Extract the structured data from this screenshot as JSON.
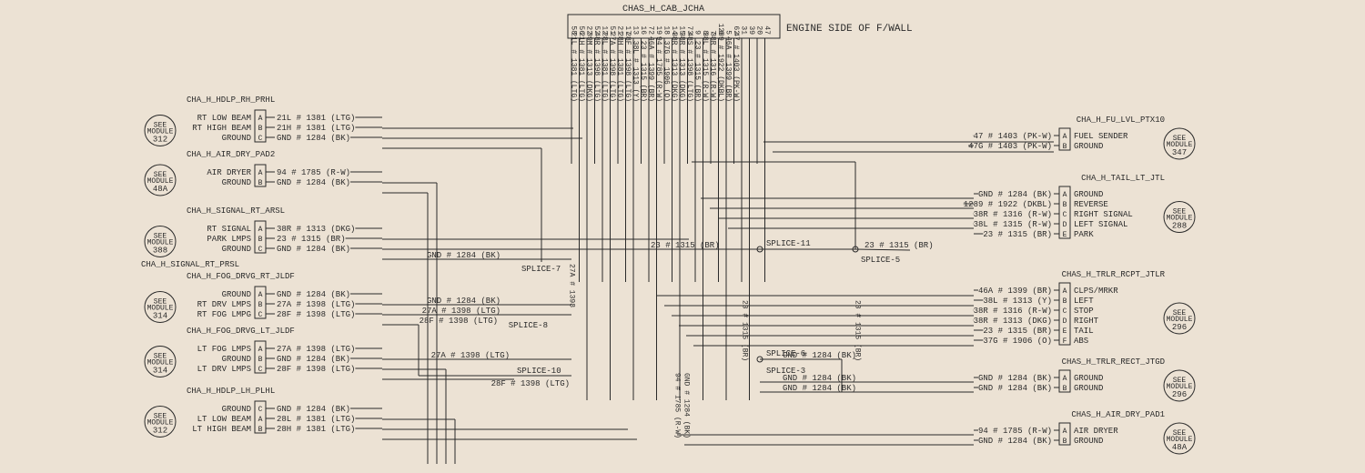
{
  "header": {
    "top_label": "CHAS_H_CAB_JCHA",
    "side_label": "ENGINE SIDE OF F/WALL",
    "pins": [
      "58",
      "56",
      "22",
      "52",
      "12",
      "51",
      "21",
      "17",
      "13",
      "16",
      "72",
      "19",
      "18",
      "14",
      "15",
      "73",
      "9",
      "8",
      "7",
      "6",
      "5",
      "62",
      "31",
      "39",
      "20",
      "47"
    ],
    "pin_wires": [
      "21L # 1381 (LTG)",
      "21H # 1381 (LTG)",
      "39M # 1313 (DKG)",
      "48R # 1398 (LTG)",
      "28L # 1381 (LTG)",
      "27A # 1398 (LTG)",
      "28H # 1381 (LTG)",
      "28F # 1398 (LTG)",
      "38L # 1313 (Y)",
      "23 # 1315 (BR)",
      "46A # 1399 (BR)",
      "94 # 1785 (R-W)",
      "37G # 1906 (O)",
      "38R # 1313 (DKG)",
      "38R # 1313 (DKG)",
      "48S # 1398 (LTG)",
      "23 # 1315 (BR)",
      "38L # 1315 (R-W)",
      "38R # 1316 (R-W)",
      "1289 # 1922 (DKBL)",
      "46A # 1399 (BR)",
      "47 # 1403 (PK-W)"
    ]
  },
  "left_connectors": [
    {
      "id": "CHA_H_HDLP_RH_PRHL",
      "module": "312",
      "pins": [
        "A",
        "B",
        "C"
      ],
      "labels": [
        "RT LOW BEAM",
        "RT HIGH BEAM",
        "GROUND"
      ],
      "wires": [
        "21L # 1381 (LTG)",
        "21H # 1381 (LTG)",
        "GND # 1284 (BK)"
      ]
    },
    {
      "id": "CHA_H_AIR_DRY_PAD2",
      "module": "48A",
      "pins": [
        "A",
        "B"
      ],
      "labels": [
        "AIR DRYER",
        "GROUND"
      ],
      "wires": [
        "94 # 1785 (R-W)",
        "GND # 1284 (BK)"
      ]
    },
    {
      "id": "CHA_H_SIGNAL_RT_ARSL",
      "module": "388",
      "pins": [
        "A",
        "B",
        "C"
      ],
      "labels": [
        "RT SIGNAL",
        "PARK LMPS",
        "GROUND"
      ],
      "wires": [
        "38R # 1313 (DKG)",
        "23 # 1315 (BR)",
        "GND # 1284 (BK)"
      ],
      "sub": "CHA_H_SIGNAL_RT_PRSL"
    },
    {
      "id": "CHA_H_FOG_DRVG_RT_JLDF",
      "module": "314",
      "pins": [
        "A",
        "B",
        "C"
      ],
      "labels": [
        "GROUND",
        "RT DRV LMPS",
        "RT FOG LMPG"
      ],
      "wires": [
        "GND # 1284 (BK)",
        "27A # 1398 (LTG)",
        "28F # 1398 (LTG)"
      ]
    },
    {
      "id": "CHA_H_FOG_DRVG_LT_JLDF",
      "module": "314",
      "pins": [
        "A",
        "B",
        "C"
      ],
      "labels": [
        "LT FOG LMPS",
        "GROUND",
        "LT DRV LMPS"
      ],
      "wires": [
        "27A # 1398 (LTG)",
        "GND # 1284 (BK)",
        "28F # 1398 (LTG)"
      ]
    },
    {
      "id": "CHA_H_HDLP_LH_PLHL",
      "module": "312",
      "pins": [
        "C",
        "A",
        "B"
      ],
      "labels": [
        "GROUND",
        "LT LOW BEAM",
        "LT HIGH BEAM"
      ],
      "wires": [
        "GND # 1284 (BK)",
        "28L # 1381 (LTG)",
        "28H # 1381 (LTG)"
      ]
    }
  ],
  "right_connectors": [
    {
      "id": "CHA_H_FU_LVL_PTX10",
      "module": "347",
      "pins": [
        "A",
        "B"
      ],
      "labels": [
        "FUEL SENDER",
        "GROUND"
      ],
      "wires": [
        "47 # 1403 (PK-W)",
        "47G # 1403 (PK-W)"
      ]
    },
    {
      "id": "CHA_H_TAIL_LT_JTL",
      "module": "288",
      "pins": [
        "A",
        "B",
        "C",
        "D"
      ],
      "labels": [
        "GROUND",
        "REVERSE",
        "RIGHT SIGNAL",
        "LEFT SIGNAL",
        "PARK"
      ],
      "wires": [
        "GND # 1284 (BK)",
        "1289 # 1922 (DKBL)",
        "38R # 1316 (R-W)",
        "38L # 1315 (R-W)",
        "23 # 1315 (BR)"
      ]
    },
    {
      "id": "CHAS_H_TRLR_RCPT_JTLR",
      "module": "296",
      "pins": [
        "A",
        "B",
        "C",
        "D",
        "E",
        "F"
      ],
      "labels": [
        "CLPS/MRKR",
        "LEFT",
        "STOP",
        "RIGHT",
        "TAIL",
        "ABS"
      ],
      "wires": [
        "46A # 1399 (BR)",
        "38L # 1313 (Y)",
        "38R # 1316 (R-W)",
        "38R # 1313 (DKG)",
        "23 # 1315 (BR)",
        "37G # 1906 (O)"
      ]
    },
    {
      "id": "CHAS_H_TRLR_RECT_JTGD",
      "module": "296",
      "pins": [
        "A",
        "B"
      ],
      "labels": [
        "GROUND",
        "GROUND"
      ],
      "wires": [
        "GND # 1284 (BK)",
        "GND # 1284 (BK)"
      ]
    },
    {
      "id": "CHAS_H_AIR_DRY_PAD1",
      "module": "48A",
      "pins": [
        "A",
        "B"
      ],
      "labels": [
        "AIR DRYER",
        "GROUND"
      ],
      "wires": [
        "94 # 1785 (R-W)",
        "GND # 1284 (BK)"
      ]
    }
  ],
  "splices": {
    "s3": "SPLICE-3",
    "s5": "SPLICE-5",
    "s6": "SPLICE-6",
    "s7": "SPLICE-7",
    "s8": "SPLICE-8",
    "s10": "SPLICE-10",
    "s11": "SPLICE-11"
  },
  "misc": {
    "see": "SEE",
    "module": "MODULE",
    "gnd": "GND # 1284 (BK)",
    "ang": "23 # 1315 (BR)",
    "s7a": "27A # 1398",
    "s8a": "GND # 1284 (BK)",
    "s8b": "27A # 1398 (LTG)",
    "s8c": "28F # 1398 (LTG)",
    "s10a": "27A # 1398 (LTG)",
    "s10b": "28F # 1398 (LTG)",
    "s10c": "28F # 1398 (LTG)",
    "s6a": "GND # 1284 (BK)",
    "s6b": "GND # 1284 (BK)",
    "s6c": "GND # 1284 (BK)",
    "v1": "94 # 1785 (R-W)",
    "v2": "GND # 1284 (BK)",
    "v3": "23 # 1315 (BR)",
    "v4": "23 # 1315 (BR)"
  }
}
